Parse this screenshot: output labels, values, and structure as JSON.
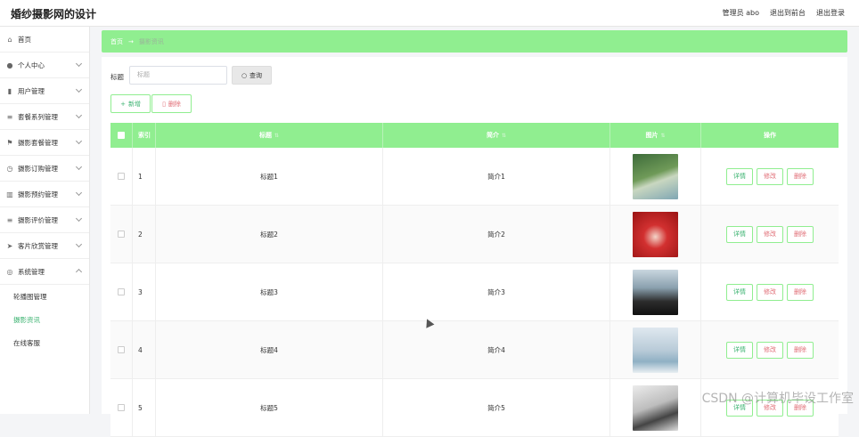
{
  "header": {
    "app_title": "婚纱摄影网的设计",
    "links": [
      "管理员 abo",
      "退出到前台",
      "退出登录"
    ]
  },
  "sidebar": {
    "items": [
      {
        "label": "首页",
        "icon": "home-icon",
        "chevron": false
      },
      {
        "label": "个人中心",
        "icon": "user-icon",
        "chevron": true
      },
      {
        "label": "用户管理",
        "icon": "chart-icon",
        "chevron": true
      },
      {
        "label": "套餐系列管理",
        "icon": "list-icon",
        "chevron": true
      },
      {
        "label": "摄影套餐管理",
        "icon": "flag-icon",
        "chevron": true
      },
      {
        "label": "摄影订购管理",
        "icon": "clock-icon",
        "chevron": true
      },
      {
        "label": "摄影预约管理",
        "icon": "bars-icon",
        "chevron": true
      },
      {
        "label": "摄影评价管理",
        "icon": "menu-icon",
        "chevron": true
      },
      {
        "label": "客片欣赏管理",
        "icon": "send-icon",
        "chevron": true
      },
      {
        "label": "系统管理",
        "icon": "settings-icon",
        "chevron": true,
        "expanded": true
      }
    ],
    "sub_items": [
      {
        "label": "轮播图管理",
        "active": false
      },
      {
        "label": "摄影资讯",
        "active": true
      },
      {
        "label": "在线客服",
        "active": false
      }
    ]
  },
  "breadcrumb": {
    "home": "首页",
    "arrow": "→",
    "current": "摄影资讯"
  },
  "search": {
    "label": "标题",
    "placeholder": "标题",
    "button": "查询"
  },
  "actions": {
    "add": "新增",
    "delete": "删除"
  },
  "table": {
    "columns": [
      "索引",
      "标题",
      "简介",
      "图片",
      "操作"
    ],
    "rows": [
      {
        "index": "1",
        "title": "标题1",
        "intro": "简介1"
      },
      {
        "index": "2",
        "title": "标题2",
        "intro": "简介2"
      },
      {
        "index": "3",
        "title": "标题3",
        "intro": "简介3"
      },
      {
        "index": "4",
        "title": "标题4",
        "intro": "简介4"
      },
      {
        "index": "5",
        "title": "标题5",
        "intro": "简介5"
      }
    ],
    "op_labels": {
      "detail": "详情",
      "edit": "修改",
      "delete": "删除"
    }
  },
  "watermark": "CSDN @计算机毕设工作室",
  "colors": {
    "accent": "#90ee90",
    "accent_text": "#3cb371",
    "danger": "#e06c75"
  }
}
